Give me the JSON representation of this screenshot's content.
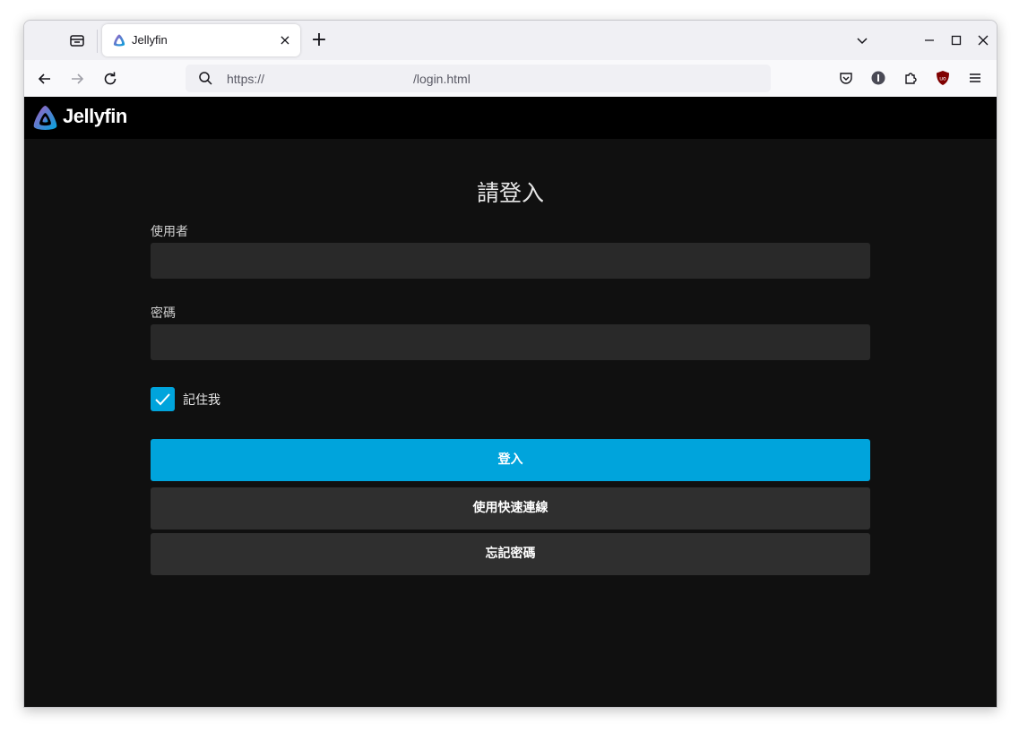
{
  "browser": {
    "tab": {
      "title": "Jellyfin",
      "favicon": "jellyfin-logo-icon",
      "close_label": "×"
    },
    "newtab_label": "+",
    "url": {
      "prefix": "https://",
      "path": "/login.html"
    },
    "toolbar_icons": [
      "pocket-icon",
      "extension-info-icon",
      "extensions-puzzle-icon",
      "ublock-origin-icon",
      "menu-icon"
    ]
  },
  "app": {
    "brand": "Jellyfin",
    "brand_colors": {
      "purple": "#aa5cc3",
      "blue": "#00a4dc"
    }
  },
  "login": {
    "title": "請登入",
    "username_label": "使用者",
    "username_value": "",
    "password_label": "密碼",
    "password_value": "",
    "remember_label": "記住我",
    "remember_checked": true,
    "signin_button": "登入",
    "quick_connect_button": "使用快速連線",
    "forgot_password_button": "忘記密碼"
  },
  "colors": {
    "accent": "#00a4dc",
    "page_background": "#101010",
    "header_background": "#000000",
    "input_background": "#292929",
    "secondary_button": "#2f2f2f"
  }
}
